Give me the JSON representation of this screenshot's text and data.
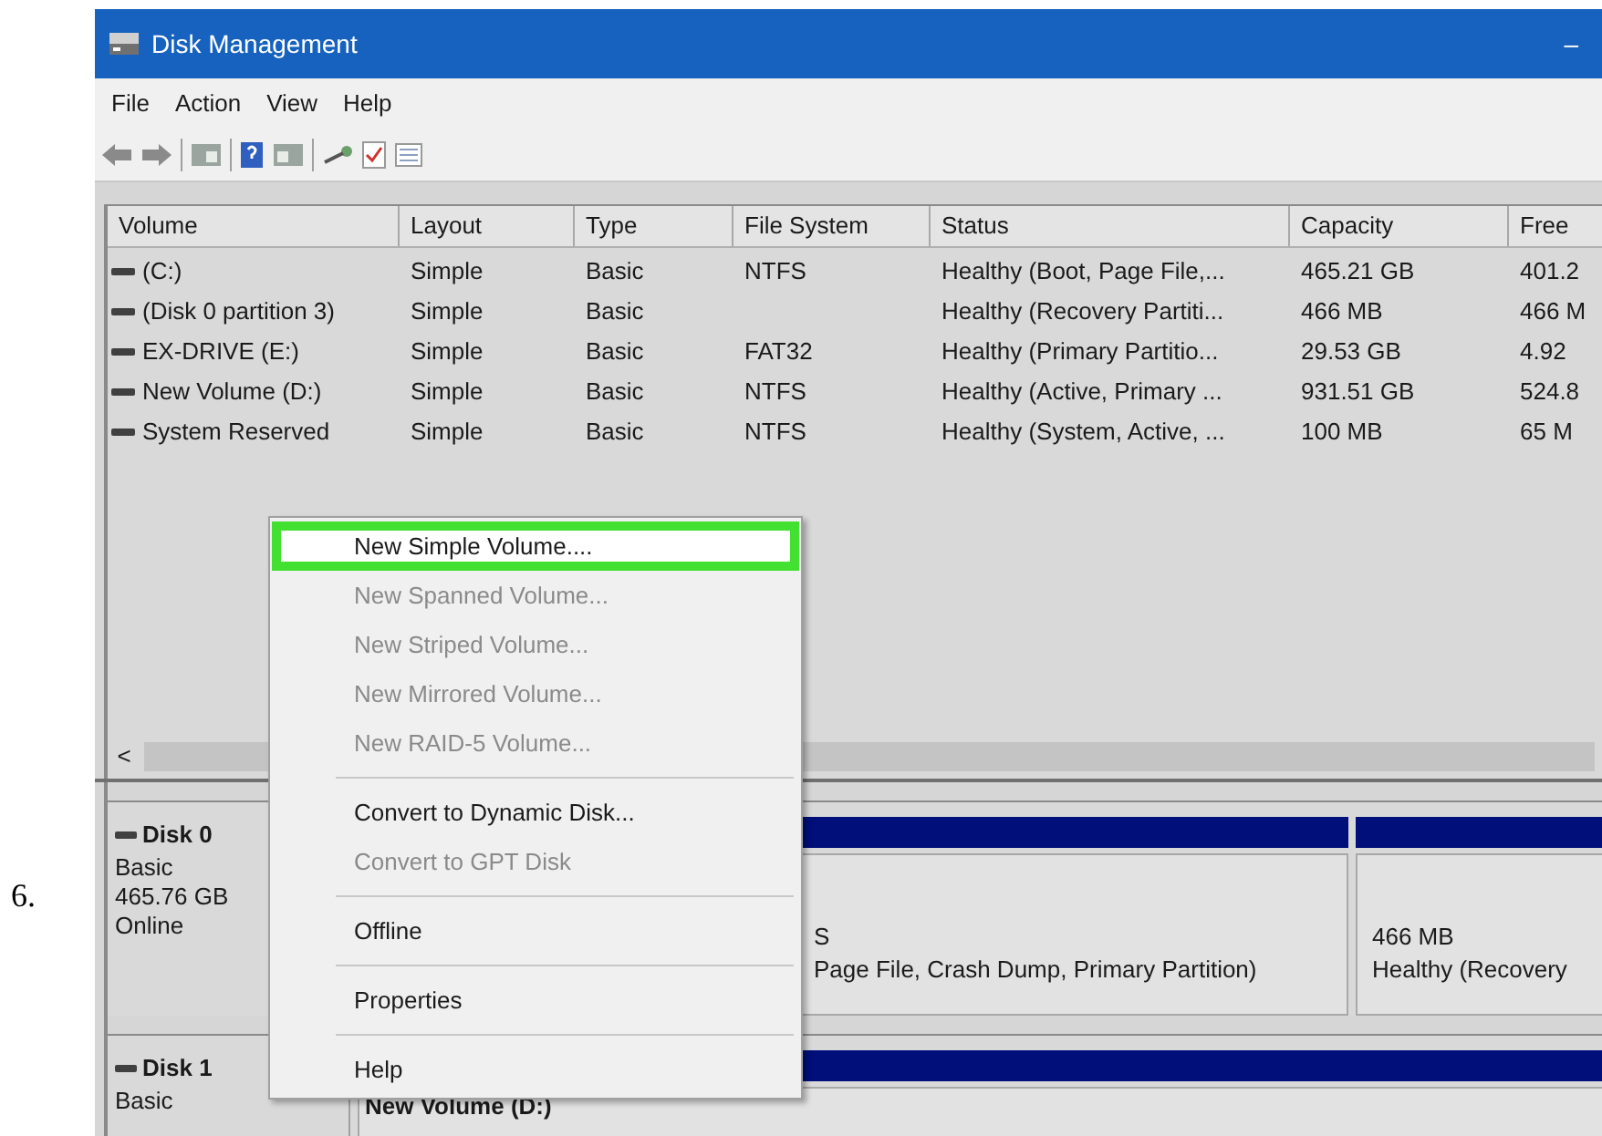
{
  "step_label": "6.",
  "window": {
    "title": "Disk Management",
    "minimize": "–"
  },
  "menu_bar": [
    "File",
    "Action",
    "View",
    "Help"
  ],
  "volume_table": {
    "columns": [
      "Volume",
      "Layout",
      "Type",
      "File System",
      "Status",
      "Capacity",
      "Free"
    ],
    "rows": [
      {
        "cells": [
          "(C:)",
          "Simple",
          "Basic",
          "NTFS",
          "Healthy (Boot, Page File,...",
          "465.21 GB",
          "401.2"
        ]
      },
      {
        "cells": [
          "(Disk 0 partition 3)",
          "Simple",
          "Basic",
          "",
          "Healthy (Recovery Partiti...",
          "466 MB",
          "466 M"
        ]
      },
      {
        "cells": [
          "EX-DRIVE (E:)",
          "Simple",
          "Basic",
          "FAT32",
          "Healthy (Primary Partitio...",
          "29.53 GB",
          "4.92"
        ]
      },
      {
        "cells": [
          "New Volume (D:)",
          "Simple",
          "Basic",
          "NTFS",
          "Healthy (Active, Primary ...",
          "931.51 GB",
          "524.8"
        ]
      },
      {
        "cells": [
          "System Reserved",
          "Simple",
          "Basic",
          "NTFS",
          "Healthy (System, Active, ...",
          "100 MB",
          "65 M"
        ]
      }
    ],
    "scroll_left": "<"
  },
  "disks": [
    {
      "name": "Disk 0",
      "details": [
        "Basic",
        "465.76 GB",
        "Online"
      ],
      "partitions": [
        {
          "lines": [
            "S",
            "Page File, Crash Dump, Primary Partition)"
          ]
        },
        {
          "lines": [
            "466 MB",
            "Healthy (Recovery"
          ]
        }
      ]
    },
    {
      "name": "Disk 1",
      "details": [
        "Basic"
      ],
      "partitions": [
        {
          "title": "New Volume  (D:)"
        }
      ]
    }
  ],
  "context_menu": [
    {
      "kind": "item",
      "label": "New Simple Volume....",
      "disabled": false,
      "selected": true
    },
    {
      "kind": "item",
      "label": "New Spanned Volume...",
      "disabled": true,
      "selected": false
    },
    {
      "kind": "item",
      "label": "New Striped Volume...",
      "disabled": true,
      "selected": false
    },
    {
      "kind": "item",
      "label": "New Mirrored Volume...",
      "disabled": true,
      "selected": false
    },
    {
      "kind": "item",
      "label": "New RAID-5 Volume...",
      "disabled": true,
      "selected": false
    },
    {
      "kind": "separator"
    },
    {
      "kind": "item",
      "label": "Convert to Dynamic Disk...",
      "disabled": false,
      "selected": false
    },
    {
      "kind": "item",
      "label": "Convert to GPT Disk",
      "disabled": true,
      "selected": false
    },
    {
      "kind": "separator"
    },
    {
      "kind": "item",
      "label": "Offline",
      "disabled": false,
      "selected": false
    },
    {
      "kind": "separator"
    },
    {
      "kind": "item",
      "label": "Properties",
      "disabled": false,
      "selected": false
    },
    {
      "kind": "separator"
    },
    {
      "kind": "item",
      "label": "Help",
      "disabled": false,
      "selected": false
    }
  ]
}
